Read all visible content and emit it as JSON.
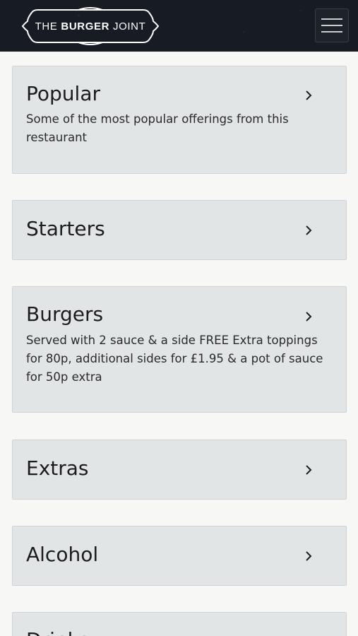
{
  "header": {
    "brand_prefix": "THE",
    "brand_bold": "BURGER",
    "brand_suffix": "JOINT",
    "menu_icon": "hamburger-menu-icon"
  },
  "categories": [
    {
      "title": "Popular",
      "description": "Some of the most popular offerings from this restaurant",
      "icon": "chevron-right-icon"
    },
    {
      "title": "Starters",
      "description": "",
      "icon": "chevron-right-icon"
    },
    {
      "title": "Burgers",
      "description": "Served with 2 sauce & a side FREE Extra toppings for 80p, additional sides for £1.95 & a pot of sauce for 50p extra",
      "icon": "chevron-right-icon"
    },
    {
      "title": "Extras",
      "description": "",
      "icon": "chevron-right-icon"
    },
    {
      "title": "Alcohol",
      "description": "",
      "icon": "chevron-right-icon"
    },
    {
      "title": "Drinks",
      "description": "",
      "icon": "chevron-right-icon"
    }
  ]
}
